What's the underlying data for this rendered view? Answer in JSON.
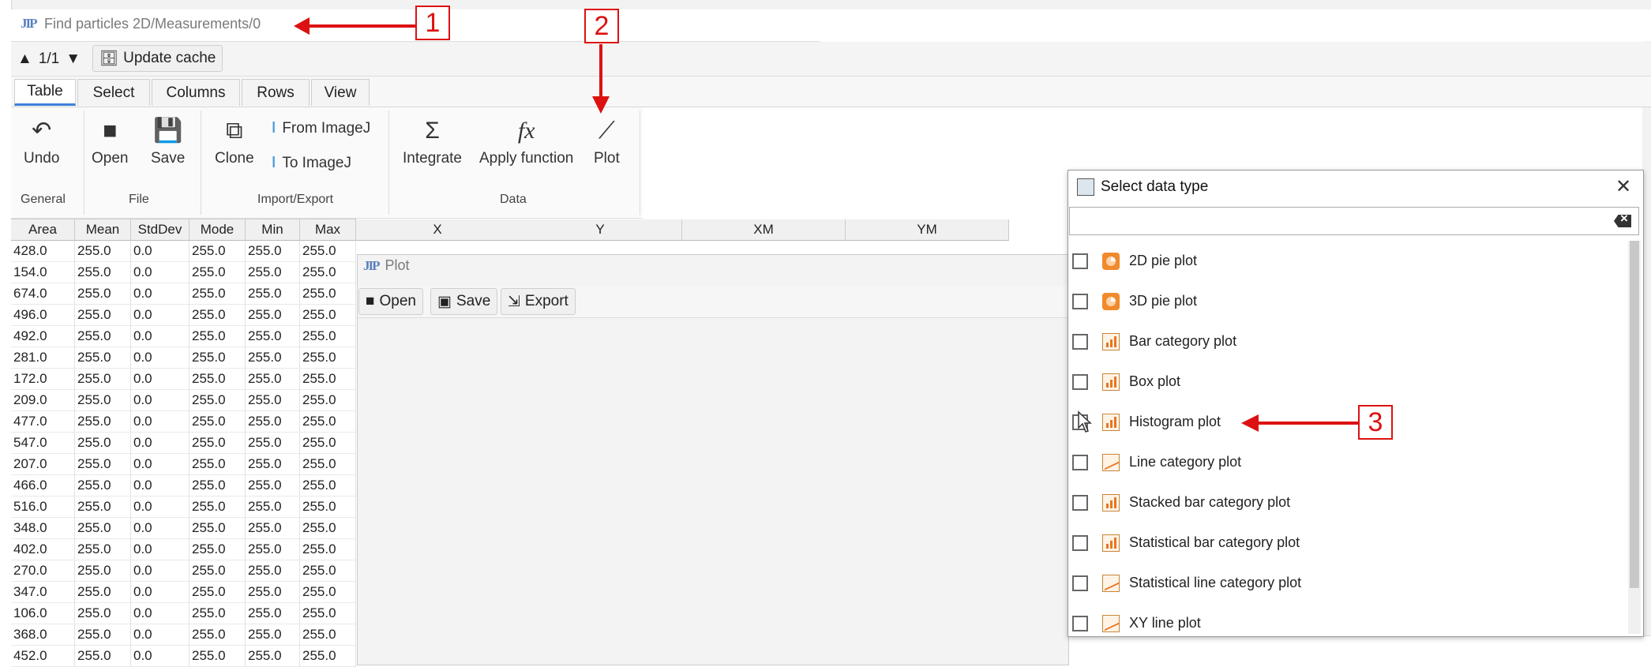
{
  "window": {
    "title": "Find particles 2D/Measurements/0",
    "logo": "JIP"
  },
  "toolbar": {
    "pager": "1/1",
    "update_cache": "Update cache"
  },
  "tabs": [
    "Table",
    "Select",
    "Columns",
    "Rows",
    "View"
  ],
  "ribbon": {
    "undo": "Undo",
    "open": "Open",
    "save": "Save",
    "clone": "Clone",
    "from_imagej": "From ImageJ",
    "to_imagej": "To ImageJ",
    "integrate": "Integrate",
    "apply_function": "Apply function",
    "plot": "Plot",
    "groups": {
      "general": "General",
      "file": "File",
      "import_export": "Import/Export",
      "data": "Data"
    }
  },
  "table": {
    "columns": [
      "Area",
      "Mean",
      "StdDev",
      "Mode",
      "Min",
      "Max"
    ],
    "extra_columns": [
      "X",
      "Y",
      "XM",
      "YM"
    ],
    "rows": [
      [
        "428.0",
        "255.0",
        "0.0",
        "255.0",
        "255.0",
        "255.0"
      ],
      [
        "154.0",
        "255.0",
        "0.0",
        "255.0",
        "255.0",
        "255.0"
      ],
      [
        "674.0",
        "255.0",
        "0.0",
        "255.0",
        "255.0",
        "255.0"
      ],
      [
        "496.0",
        "255.0",
        "0.0",
        "255.0",
        "255.0",
        "255.0"
      ],
      [
        "492.0",
        "255.0",
        "0.0",
        "255.0",
        "255.0",
        "255.0"
      ],
      [
        "281.0",
        "255.0",
        "0.0",
        "255.0",
        "255.0",
        "255.0"
      ],
      [
        "172.0",
        "255.0",
        "0.0",
        "255.0",
        "255.0",
        "255.0"
      ],
      [
        "209.0",
        "255.0",
        "0.0",
        "255.0",
        "255.0",
        "255.0"
      ],
      [
        "477.0",
        "255.0",
        "0.0",
        "255.0",
        "255.0",
        "255.0"
      ],
      [
        "547.0",
        "255.0",
        "0.0",
        "255.0",
        "255.0",
        "255.0"
      ],
      [
        "207.0",
        "255.0",
        "0.0",
        "255.0",
        "255.0",
        "255.0"
      ],
      [
        "466.0",
        "255.0",
        "0.0",
        "255.0",
        "255.0",
        "255.0"
      ],
      [
        "516.0",
        "255.0",
        "0.0",
        "255.0",
        "255.0",
        "255.0"
      ],
      [
        "348.0",
        "255.0",
        "0.0",
        "255.0",
        "255.0",
        "255.0"
      ],
      [
        "402.0",
        "255.0",
        "0.0",
        "255.0",
        "255.0",
        "255.0"
      ],
      [
        "270.0",
        "255.0",
        "0.0",
        "255.0",
        "255.0",
        "255.0"
      ],
      [
        "347.0",
        "255.0",
        "0.0",
        "255.0",
        "255.0",
        "255.0"
      ],
      [
        "106.0",
        "255.0",
        "0.0",
        "255.0",
        "255.0",
        "255.0"
      ],
      [
        "368.0",
        "255.0",
        "0.0",
        "255.0",
        "255.0",
        "255.0"
      ],
      [
        "452.0",
        "255.0",
        "0.0",
        "255.0",
        "255.0",
        "255.0"
      ]
    ]
  },
  "plot_window": {
    "title": "Plot",
    "logo": "JIP",
    "open": "Open",
    "save": "Save",
    "export": "Export"
  },
  "dialog": {
    "title": "Select data type",
    "search_value": "",
    "items": [
      {
        "label": "2D pie plot",
        "icon": "pie-chart-icon"
      },
      {
        "label": "3D pie plot",
        "icon": "pie-chart-icon"
      },
      {
        "label": "Bar category plot",
        "icon": "bar-chart-icon"
      },
      {
        "label": "Box plot",
        "icon": "bar-chart-icon"
      },
      {
        "label": "Histogram plot",
        "icon": "bar-chart-icon"
      },
      {
        "label": "Line category plot",
        "icon": "line-chart-icon"
      },
      {
        "label": "Stacked bar category plot",
        "icon": "bar-chart-icon"
      },
      {
        "label": "Statistical bar category plot",
        "icon": "bar-chart-icon"
      },
      {
        "label": "Statistical line category plot",
        "icon": "line-chart-icon"
      },
      {
        "label": "XY line plot",
        "icon": "line-chart-icon"
      }
    ]
  },
  "annotations": [
    "1",
    "2",
    "3"
  ],
  "colors": {
    "annotation": "#dd1111",
    "accent_tab": "#3d7fd9",
    "chart_icon": "#e8761f"
  }
}
